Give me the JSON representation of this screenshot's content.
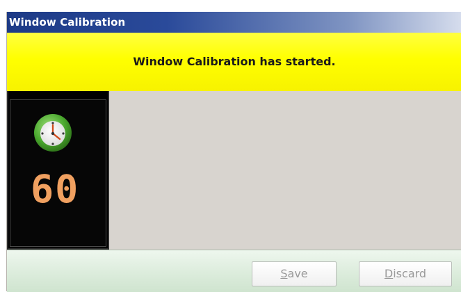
{
  "window": {
    "title": "Window Calibration"
  },
  "banner": {
    "message": "Window Calibration has started."
  },
  "timer": {
    "value": "60",
    "icon": "clock-icon"
  },
  "footer": {
    "save": {
      "underline": "S",
      "rest": "ave"
    },
    "discard": {
      "underline": "D",
      "rest": "iscard"
    }
  },
  "colors": {
    "title_bar": "#2a4a9a",
    "banner": "#ffff00",
    "timer_digits": "#f0a060",
    "content_bg": "#d8d4cf",
    "footer_bg": "#dcecdc"
  }
}
